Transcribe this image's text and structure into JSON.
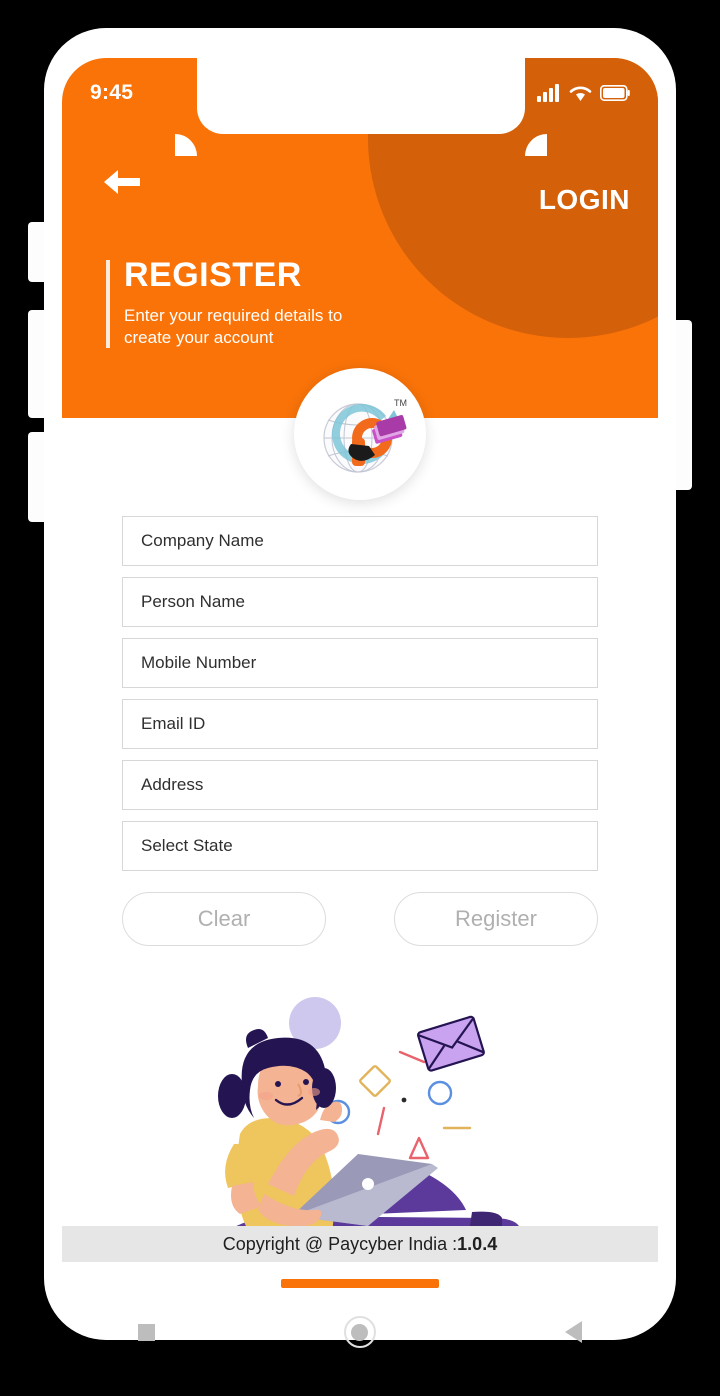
{
  "statusbar": {
    "time": "9:45",
    "icons": [
      "signal-icon",
      "wifi-icon",
      "battery-icon"
    ]
  },
  "header": {
    "back_icon": "back-arrow-icon",
    "login_label": "LOGIN",
    "title": "REGISTER",
    "subtitle": "Enter your required details to create your account",
    "bg_color": "#F97309",
    "accent_circle_color": "#D4600A"
  },
  "logo": {
    "name": "paycyber-logo",
    "trademark": "TM"
  },
  "form": {
    "fields": [
      {
        "name": "company-name",
        "placeholder": "Company Name",
        "value": ""
      },
      {
        "name": "person-name",
        "placeholder": "Person Name",
        "value": ""
      },
      {
        "name": "mobile-number",
        "placeholder": "Mobile Number",
        "value": ""
      },
      {
        "name": "email-id",
        "placeholder": "Email ID",
        "value": ""
      },
      {
        "name": "address",
        "placeholder": "Address",
        "value": ""
      },
      {
        "name": "select-state",
        "placeholder": "Select State",
        "value": ""
      }
    ],
    "clear_label": "Clear",
    "register_label": "Register"
  },
  "illustration": {
    "name": "woman-with-laptop-illustration",
    "shirt_color": "#EFC55E",
    "pants_color": "#5B3A9B",
    "hair_color": "#231446",
    "envelope_color": "#C9A3F0"
  },
  "footer": {
    "copyright": "Copyright @ Paycyber India : ",
    "version": "1.0.4"
  },
  "navbar": {
    "recents_icon": "square-icon",
    "home_icon": "circle-icon",
    "back_icon": "triangle-back-icon"
  }
}
